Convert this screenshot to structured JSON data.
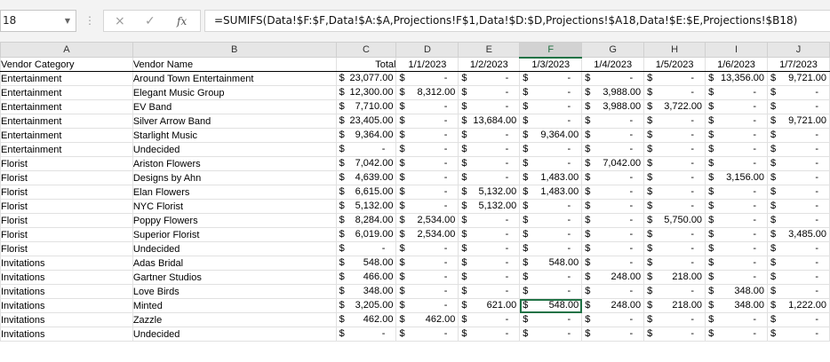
{
  "name_box": "18",
  "formula_bar": {
    "cancel_icon": "×",
    "enter_icon": "✓",
    "fx_icon": "fx",
    "formula": "=SUMIFS(Data!$F:$F,Data!$A:$A,Projections!F$1,Data!$D:$D,Projections!$A18,Data!$E:$E,Projections!$B18)"
  },
  "columns": [
    "A",
    "B",
    "C",
    "D",
    "E",
    "F",
    "G",
    "H",
    "I",
    "J"
  ],
  "selected_column": "F",
  "header_row": [
    "Vendor Category",
    "Vendor Name",
    "Total",
    "1/1/2023",
    "1/2/2023",
    "1/3/2023",
    "1/4/2023",
    "1/5/2023",
    "1/6/2023",
    "1/7/2023"
  ],
  "currency_symbol": "$",
  "rows": [
    [
      "Entertainment",
      "Around Town Entertainment",
      "23,077.00",
      "-",
      "-",
      "-",
      "-",
      "-",
      "13,356.00",
      "9,721.00"
    ],
    [
      "Entertainment",
      "Elegant Music Group",
      "12,300.00",
      "8,312.00",
      "-",
      "-",
      "3,988.00",
      "-",
      "-",
      "-"
    ],
    [
      "Entertainment",
      "EV Band",
      "7,710.00",
      "-",
      "-",
      "-",
      "3,988.00",
      "3,722.00",
      "-",
      "-"
    ],
    [
      "Entertainment",
      "Silver Arrow Band",
      "23,405.00",
      "-",
      "13,684.00",
      "-",
      "-",
      "-",
      "-",
      "9,721.00"
    ],
    [
      "Entertainment",
      "Starlight Music",
      "9,364.00",
      "-",
      "-",
      "9,364.00",
      "-",
      "-",
      "-",
      "-"
    ],
    [
      "Entertainment",
      "Undecided",
      "-",
      "-",
      "-",
      "-",
      "-",
      "-",
      "-",
      "-"
    ],
    [
      "Florist",
      "Ariston Flowers",
      "7,042.00",
      "-",
      "-",
      "-",
      "7,042.00",
      "-",
      "-",
      "-"
    ],
    [
      "Florist",
      "Designs by Ahn",
      "4,639.00",
      "-",
      "-",
      "1,483.00",
      "-",
      "-",
      "3,156.00",
      "-"
    ],
    [
      "Florist",
      "Elan Flowers",
      "6,615.00",
      "-",
      "5,132.00",
      "1,483.00",
      "-",
      "-",
      "-",
      "-"
    ],
    [
      "Florist",
      "NYC Florist",
      "5,132.00",
      "-",
      "5,132.00",
      "-",
      "-",
      "-",
      "-",
      "-"
    ],
    [
      "Florist",
      "Poppy Flowers",
      "8,284.00",
      "2,534.00",
      "-",
      "-",
      "-",
      "5,750.00",
      "-",
      "-"
    ],
    [
      "Florist",
      "Superior Florist",
      "6,019.00",
      "2,534.00",
      "-",
      "-",
      "-",
      "-",
      "-",
      "3,485.00"
    ],
    [
      "Florist",
      "Undecided",
      "-",
      "-",
      "-",
      "-",
      "-",
      "-",
      "-",
      "-"
    ],
    [
      "Invitations",
      "Adas Bridal",
      "548.00",
      "-",
      "-",
      "548.00",
      "-",
      "-",
      "-",
      "-"
    ],
    [
      "Invitations",
      "Gartner Studios",
      "466.00",
      "-",
      "-",
      "-",
      "248.00",
      "218.00",
      "-",
      "-"
    ],
    [
      "Invitations",
      "Love Birds",
      "348.00",
      "-",
      "-",
      "-",
      "-",
      "-",
      "348.00",
      "-"
    ],
    [
      "Invitations",
      "Minted",
      "3,205.00",
      "-",
      "621.00",
      "548.00",
      "248.00",
      "218.00",
      "348.00",
      "1,222.00"
    ],
    [
      "Invitations",
      "Zazzle",
      "462.00",
      "462.00",
      "-",
      "-",
      "-",
      "-",
      "-",
      "-"
    ],
    [
      "Invitations",
      "Undecided",
      "-",
      "-",
      "-",
      "-",
      "-",
      "-",
      "-",
      "-"
    ]
  ],
  "active_cell": {
    "row": 16,
    "col": 5
  }
}
